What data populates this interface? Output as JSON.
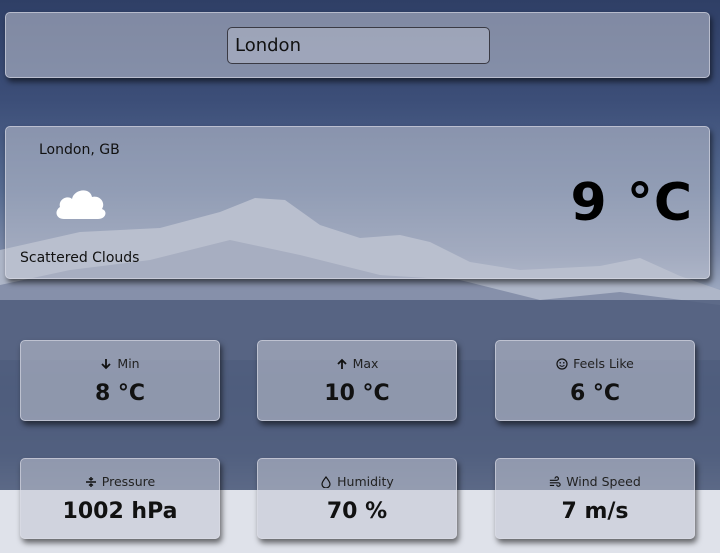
{
  "search": {
    "value": "London"
  },
  "current": {
    "location": "London, GB",
    "condition": "Scattered Clouds",
    "temperature": "9 °C",
    "icon": "cloud-icon"
  },
  "stats": [
    {
      "label": "Min",
      "value": "8 °C",
      "icon": "arrow-down-icon"
    },
    {
      "label": "Max",
      "value": "10 °C",
      "icon": "arrow-up-icon"
    },
    {
      "label": "Feels Like",
      "value": "6 °C",
      "icon": "smiley-icon"
    },
    {
      "label": "Pressure",
      "value": "1002 hPa",
      "icon": "compress-icon"
    },
    {
      "label": "Humidity",
      "value": "70 %",
      "icon": "droplet-icon"
    },
    {
      "label": "Wind Speed",
      "value": "7 m/s",
      "icon": "wind-icon"
    }
  ]
}
